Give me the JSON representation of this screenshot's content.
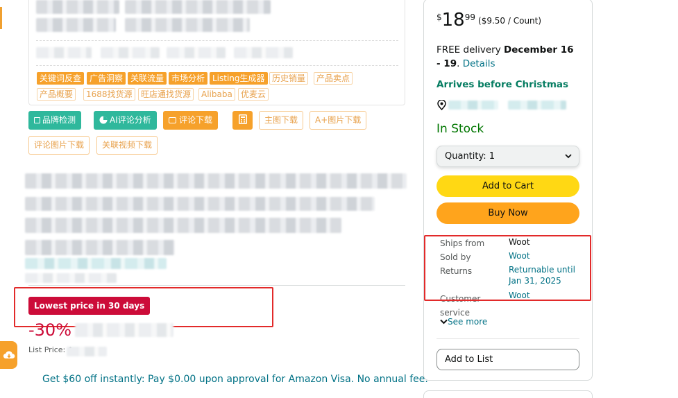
{
  "plugin": {
    "tags_row1": [
      "关键词反查",
      "广告洞察",
      "关联流量",
      "市场分析",
      "Listing生成器",
      "历史销量",
      "产品卖点"
    ],
    "tags_row2": [
      "产品概要",
      "1688找货源",
      "旺店通找货源",
      "Alibaba",
      "优麦云"
    ],
    "buttons": {
      "brand_check": "品牌检测",
      "ai_review": "AI评论分析",
      "review_download": "评论下载",
      "main_image_download": "主图下载",
      "aplus_image_download": "A+图片下载",
      "review_image_download": "评论图片下载",
      "related_video_download": "关联视频下载"
    }
  },
  "product": {
    "deal_badge": "Lowest price in 30 days",
    "discount": "-30%",
    "list_price_label": "List Price: $",
    "promo": "Get $60 off instantly: Pay $0.00 upon approval for Amazon Visa. No annual fee."
  },
  "buybox": {
    "price_symbol": "$",
    "price_whole": "18",
    "price_fraction": "99",
    "price_per_unit": "($9.50 / Count)",
    "delivery_prefix": "FREE delivery ",
    "delivery_date": "December 16 - 19",
    "delivery_suffix": ". ",
    "details_link": "Details",
    "arrives": "Arrives before Christmas",
    "stock": "In Stock",
    "quantity_label": "Quantity:",
    "quantity_value": "1",
    "add_to_cart": "Add to Cart",
    "buy_now": "Buy Now",
    "ships_from_label": "Ships from",
    "ships_from_value": "Woot",
    "sold_by_label": "Sold by",
    "sold_by_value": "Woot",
    "returns_label": "Returns",
    "returns_line1": "Returnable until",
    "returns_line2": "Jan 31, 2025",
    "customer_service_label1": "Customer",
    "customer_service_label2": "service",
    "customer_service_value": "Woot",
    "see_more": "See more",
    "add_to_list": "Add to List"
  },
  "colors": {
    "amazon_link": "#007185",
    "deal_red": "#cc0c39",
    "in_stock_green": "#007600",
    "arrives_green": "#067d62",
    "add_to_cart_yellow": "#ffd814",
    "buy_now_orange": "#ffa41c",
    "plugin_orange": "#f6a12b",
    "plugin_green": "#2fb89c",
    "annotation_red": "#e22a2a"
  }
}
